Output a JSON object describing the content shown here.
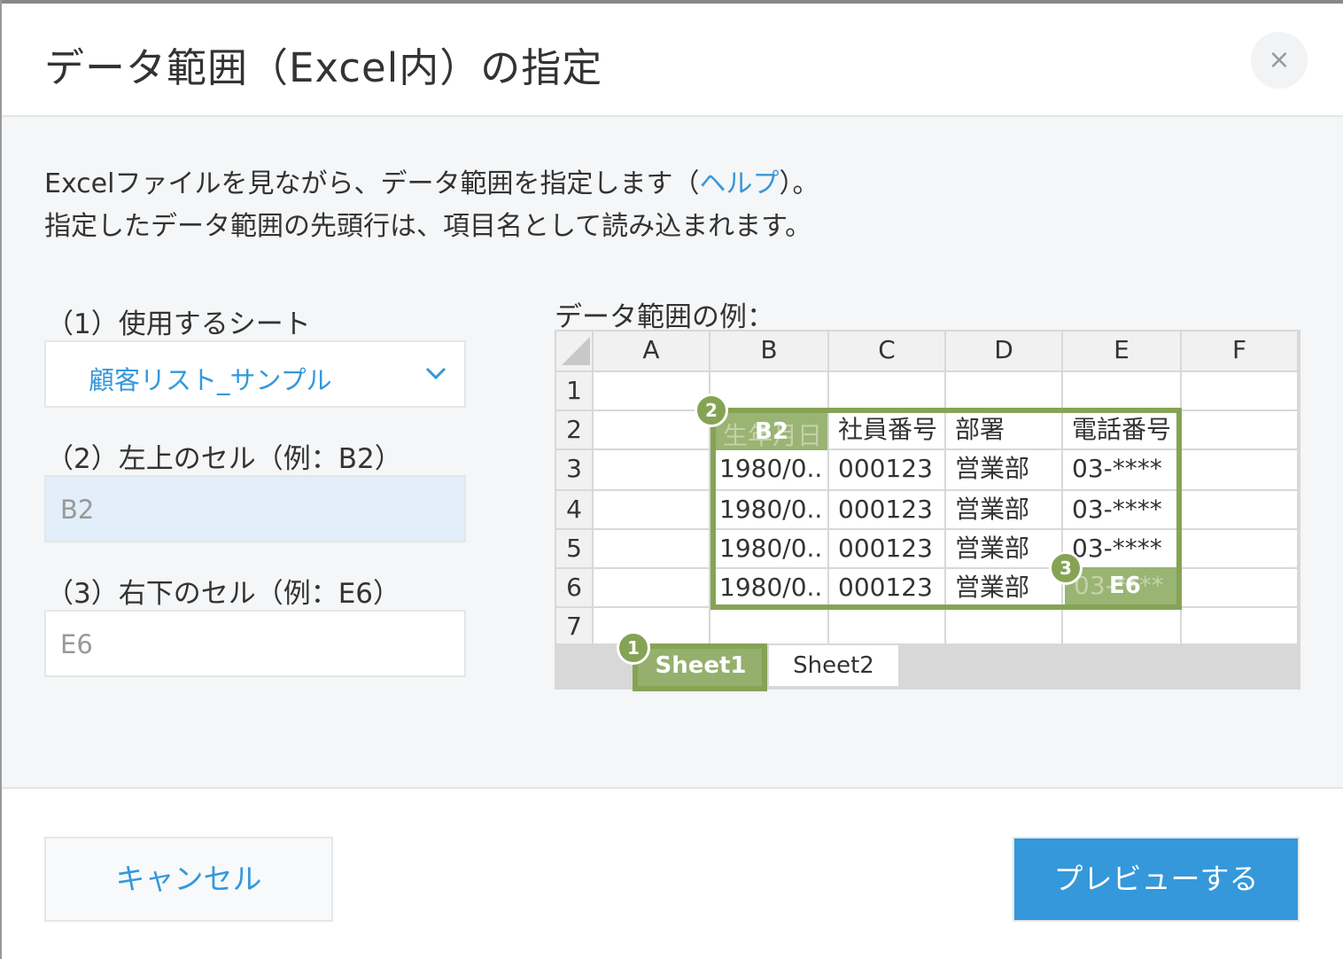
{
  "dialog": {
    "title": "データ範囲（Excel内）の指定",
    "close_icon": "×"
  },
  "description": {
    "line1_before": "Excelファイルを見ながら、データ範囲を指定します（",
    "help_link": "ヘルプ",
    "line1_after": "）。",
    "line2": "指定したデータ範囲の先頭行は、項目名として読み込まれます。"
  },
  "form": {
    "sheet_label": "（1）使用するシート",
    "sheet_value": "顧客リスト_サンプル",
    "top_left_label": "（2）左上のセル（例：B2）",
    "top_left_placeholder": "B2",
    "bottom_right_label": "（3）右下のセル（例：E6）",
    "bottom_right_placeholder": "E6"
  },
  "example": {
    "label": "データ範囲の例：",
    "columns": [
      "A",
      "B",
      "C",
      "D",
      "E",
      "F"
    ],
    "rows": [
      "1",
      "2",
      "3",
      "4",
      "5",
      "6",
      "7"
    ],
    "header_row": [
      "生年月日",
      "社員番号",
      "部署",
      "電話番号"
    ],
    "data_rows": [
      [
        "1980/0..",
        "000123",
        "営業部",
        "03-****"
      ],
      [
        "1980/0..",
        "000123",
        "営業部",
        "03-****"
      ],
      [
        "1980/0..",
        "000123",
        "営業部",
        "03-****"
      ],
      [
        "1980/0..",
        "000123",
        "営業部",
        "03-****"
      ]
    ],
    "tabs": [
      "Sheet1",
      "Sheet2"
    ],
    "badges": [
      "1",
      "2",
      "3"
    ],
    "start_cell": "B2",
    "end_cell": "E6",
    "accent_color": "#86a355"
  },
  "footer": {
    "cancel_label": "キャンセル",
    "preview_label": "プレビューする",
    "primary_color": "#3498db"
  }
}
